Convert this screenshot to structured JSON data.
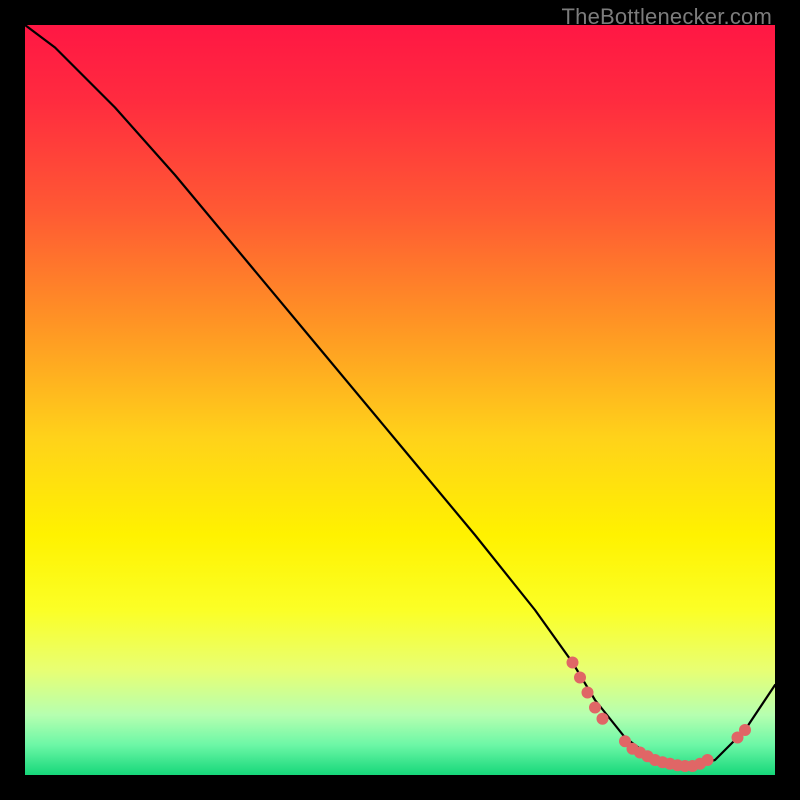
{
  "watermark": "TheBottlenecker.com",
  "gradient": {
    "stops": [
      {
        "offset": 0.0,
        "color": "#ff1744"
      },
      {
        "offset": 0.1,
        "color": "#ff2b3f"
      },
      {
        "offset": 0.25,
        "color": "#ff5a33"
      },
      {
        "offset": 0.4,
        "color": "#ff9524"
      },
      {
        "offset": 0.55,
        "color": "#ffd21a"
      },
      {
        "offset": 0.68,
        "color": "#fff200"
      },
      {
        "offset": 0.78,
        "color": "#fbff26"
      },
      {
        "offset": 0.86,
        "color": "#e8ff73"
      },
      {
        "offset": 0.92,
        "color": "#b6ffb0"
      },
      {
        "offset": 0.96,
        "color": "#6cf7a6"
      },
      {
        "offset": 1.0,
        "color": "#16d77a"
      }
    ]
  },
  "chart_data": {
    "type": "line",
    "title": "",
    "xlabel": "",
    "ylabel": "",
    "xlim": [
      0,
      100
    ],
    "ylim": [
      0,
      100
    ],
    "series": [
      {
        "name": "curve",
        "x": [
          0,
          4,
          8,
          12,
          20,
          30,
          40,
          50,
          60,
          68,
          73,
          76,
          80,
          84,
          88,
          92,
          96,
          100
        ],
        "y": [
          100,
          97,
          93,
          89,
          80,
          68,
          56,
          44,
          32,
          22,
          15,
          10,
          5,
          2,
          1,
          2,
          6,
          12
        ]
      }
    ],
    "markers": {
      "name": "highlight-dots",
      "color": "#e06666",
      "radius": 6,
      "points": [
        {
          "x": 73,
          "y": 15
        },
        {
          "x": 74,
          "y": 13
        },
        {
          "x": 75,
          "y": 11
        },
        {
          "x": 76,
          "y": 9
        },
        {
          "x": 77,
          "y": 7.5
        },
        {
          "x": 80,
          "y": 4.5
        },
        {
          "x": 81,
          "y": 3.5
        },
        {
          "x": 82,
          "y": 3
        },
        {
          "x": 83,
          "y": 2.5
        },
        {
          "x": 84,
          "y": 2
        },
        {
          "x": 85,
          "y": 1.7
        },
        {
          "x": 86,
          "y": 1.5
        },
        {
          "x": 87,
          "y": 1.3
        },
        {
          "x": 88,
          "y": 1.2
        },
        {
          "x": 89,
          "y": 1.2
        },
        {
          "x": 90,
          "y": 1.5
        },
        {
          "x": 91,
          "y": 2
        },
        {
          "x": 95,
          "y": 5
        },
        {
          "x": 96,
          "y": 6
        }
      ]
    }
  }
}
